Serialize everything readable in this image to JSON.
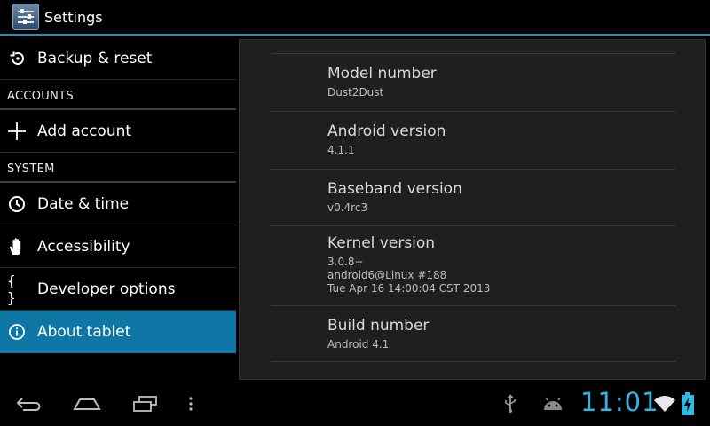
{
  "action_bar": {
    "title": "Settings",
    "icon": "settings-icon"
  },
  "sidebar": {
    "items": [
      {
        "type": "item",
        "label": "Backup & reset",
        "icon": "backup-icon",
        "selected": false
      },
      {
        "type": "header",
        "label": "ACCOUNTS"
      },
      {
        "type": "item",
        "label": "Add account",
        "icon": "plus-icon",
        "selected": false
      },
      {
        "type": "header",
        "label": "SYSTEM"
      },
      {
        "type": "item",
        "label": "Date & time",
        "icon": "clock-icon",
        "selected": false
      },
      {
        "type": "item",
        "label": "Accessibility",
        "icon": "hand-icon",
        "selected": false
      },
      {
        "type": "item",
        "label": "Developer options",
        "icon": "braces-icon",
        "selected": false
      },
      {
        "type": "item",
        "label": "About tablet",
        "icon": "info-icon",
        "selected": true
      }
    ]
  },
  "about": {
    "items": [
      {
        "title": "Model number",
        "value": "Dust2Dust"
      },
      {
        "title": "Android version",
        "value": "4.1.1"
      },
      {
        "title": "Baseband version",
        "value": "v0.4rc3"
      },
      {
        "title": "Kernel version",
        "value": "3.0.8+\nandroid6@Linux #188\nTue Apr 16 14:00:04 CST 2013"
      },
      {
        "title": "Build number",
        "value": "Android 4.1"
      }
    ]
  },
  "status_bar": {
    "time": "11:01",
    "accent_color": "#33b5e5",
    "icons": [
      "usb-icon",
      "android-debug-icon",
      "wifi-icon",
      "battery-charging-icon"
    ]
  },
  "nav_bar": {
    "buttons": [
      "back-icon",
      "home-icon",
      "recent-apps-icon",
      "menu-icon"
    ]
  },
  "colors": {
    "selection": "#0e77a6",
    "divider_accent": "#2a8bb8",
    "panel_bg": "#1f1f1f"
  }
}
